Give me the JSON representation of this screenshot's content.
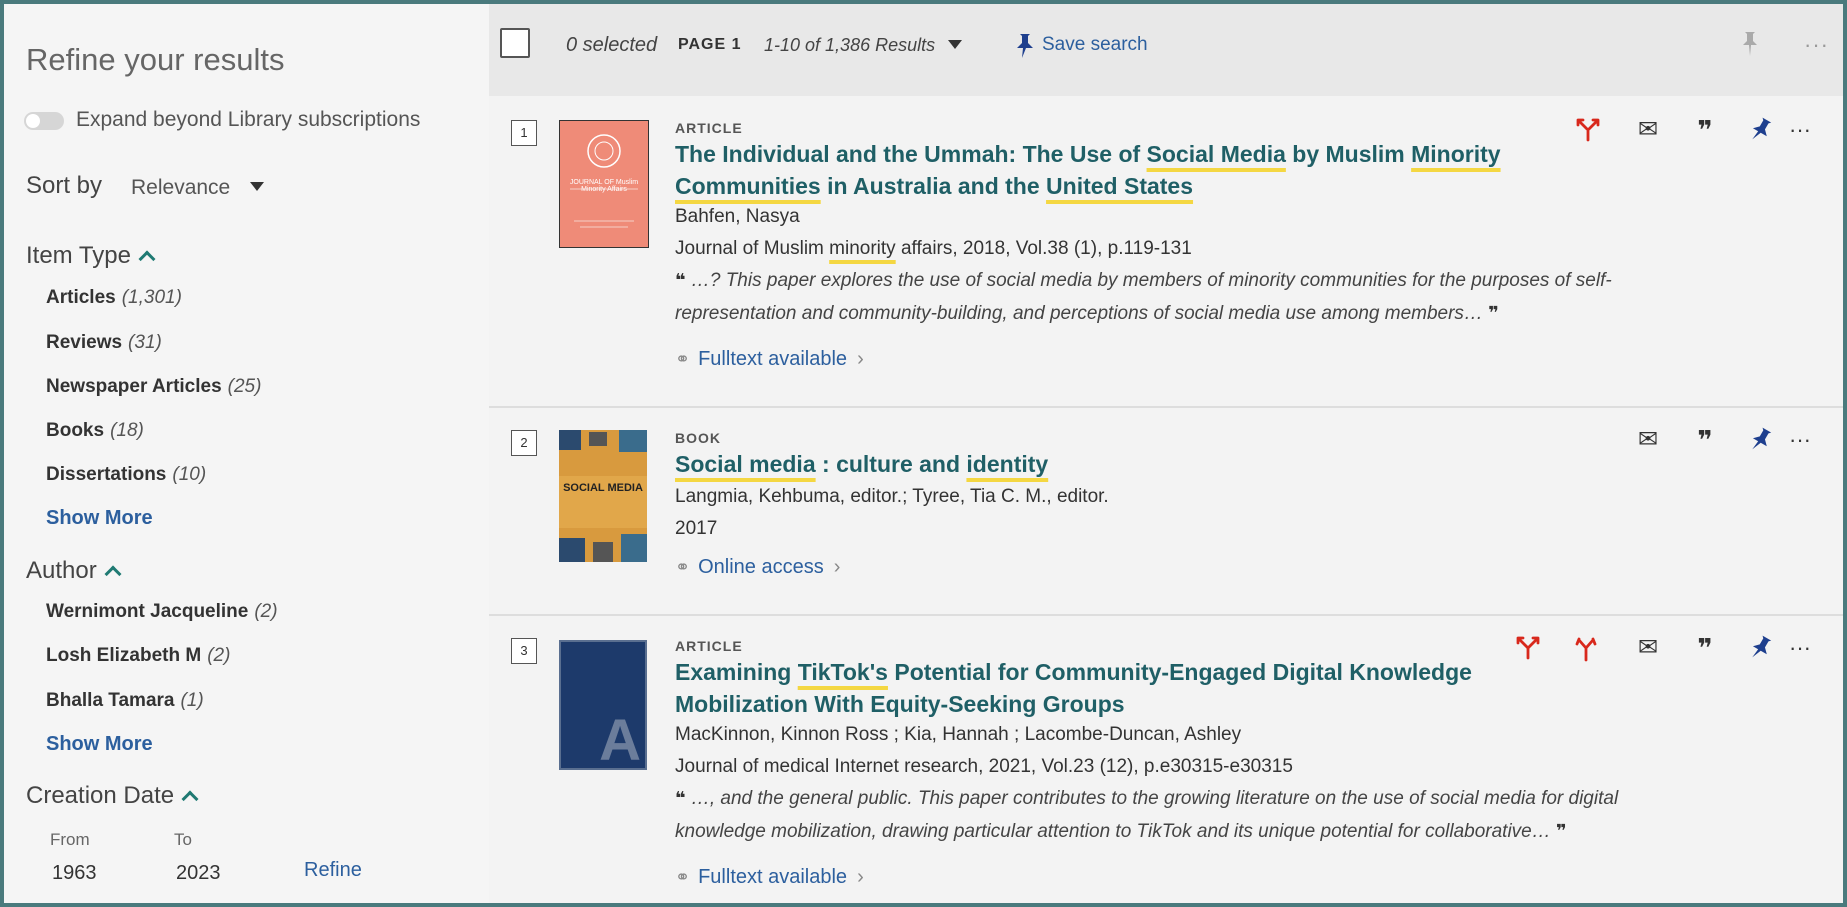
{
  "sidebar": {
    "title": "Refine your results",
    "expand_label": "Expand beyond Library subscriptions",
    "sort_label": "Sort by",
    "sort_value": "Relevance",
    "item_type": {
      "heading": "Item Type",
      "items": [
        {
          "label": "Articles",
          "count": "(1,301)"
        },
        {
          "label": "Reviews",
          "count": "(31)"
        },
        {
          "label": "Newspaper Articles",
          "count": "(25)"
        },
        {
          "label": "Books",
          "count": "(18)"
        },
        {
          "label": "Dissertations",
          "count": "(10)"
        }
      ],
      "show_more": "Show More"
    },
    "author": {
      "heading": "Author",
      "items": [
        {
          "label": "Wernimont Jacqueline",
          "count": "(2)"
        },
        {
          "label": "Losh Elizabeth M",
          "count": "(2)"
        },
        {
          "label": "Bhalla Tamara",
          "count": "(1)"
        }
      ],
      "show_more": "Show More"
    },
    "creation_date": {
      "heading": "Creation Date",
      "from_label": "From",
      "to_label": "To",
      "from_value": "1963",
      "to_value": "2023",
      "refine": "Refine"
    }
  },
  "toolbar": {
    "selected": "0 selected",
    "page": "PAGE 1",
    "results": "1-10 of 1,386 Results",
    "save_search": "Save search"
  },
  "results": [
    {
      "number": "1",
      "type": "ARTICLE",
      "title_parts": [
        "The Individual and the Ummah: The Use of ",
        "Social Media",
        " by Muslim ",
        "Minority",
        "Communities",
        " in Australia and the ",
        "United States"
      ],
      "author": "Bahfen, Nasya",
      "source_a": "Journal of Muslim ",
      "source_hl": "minority",
      "source_b": " affairs, 2018, Vol.38 (1), p.119-131",
      "snippet": "…? This paper explores the use of social media by members of minority communities for the purposes of self-representation and community-building, and perceptions of social media use among members…",
      "access": "Fulltext available",
      "thumb_text": "JOURNAL OF Muslim Minority Affairs"
    },
    {
      "number": "2",
      "type": "BOOK",
      "title_parts": [
        "Social media",
        " : culture and ",
        "identity"
      ],
      "author": "Langmia, Kehbuma, editor.; Tyree, Tia C. M., editor.",
      "year": "2017",
      "access": "Online access",
      "thumb_text": "SOCIAL MEDIA"
    },
    {
      "number": "3",
      "type": "ARTICLE",
      "title_parts": [
        "Examining ",
        "TikTok's",
        " Potential for Community-Engaged Digital Knowledge Mobilization With Equity-Seeking Groups"
      ],
      "author": "MacKinnon, Kinnon Ross ; Kia, Hannah ; Lacombe-Duncan, Ashley",
      "source": "Journal of medical Internet research, 2021, Vol.23 (12), p.e30315-e30315",
      "snippet": "…, and the general public. This paper contributes to the growing literature on the use of social media for digital knowledge mobilization, drawing particular attention to TikTok and its unique potential for collaborative…",
      "access": "Fulltext available",
      "thumb_text": "A"
    }
  ],
  "icons": {
    "quote_open": "❝",
    "quote_close": "❞",
    "link": "🔗",
    "chevron": "›",
    "more": "···",
    "pin": "📌",
    "mail": "✉",
    "citation": "❞",
    "fork": "Y"
  },
  "colors": {
    "accent": "#1f5f66",
    "link": "#2c5f9e",
    "highlight": "#f4d742",
    "action_red": "#d8281c",
    "pin_blue": "#1e3f8e"
  }
}
